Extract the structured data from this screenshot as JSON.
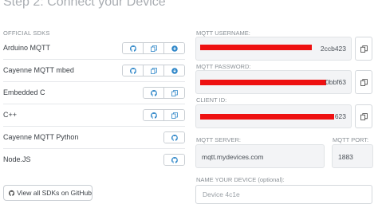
{
  "step_title": "Step 2: Connect your Device",
  "sdks": {
    "label": "OFFICIAL SDKS",
    "items": [
      {
        "name": "Arduino MQTT",
        "buttons": [
          "github-icon",
          "copy-icon",
          "download-icon"
        ]
      },
      {
        "name": "Cayenne MQTT mbed",
        "buttons": [
          "github-icon",
          "copy-icon",
          "download-icon"
        ]
      },
      {
        "name": "Embedded C",
        "buttons": [
          "github-icon",
          "copy-icon"
        ]
      },
      {
        "name": "C++",
        "buttons": [
          "github-icon",
          "copy-icon"
        ]
      },
      {
        "name": "Cayenne MQTT Python",
        "buttons": [
          "github-icon"
        ]
      },
      {
        "name": "Node.JS",
        "buttons": [
          "github-icon"
        ]
      }
    ],
    "github_button_label": "View all SDKs on GitHub"
  },
  "credentials": {
    "username_label": "MQTT USERNAME:",
    "username_value_visible": "2ccb423",
    "password_label": "MQTT PASSWORD:",
    "password_value_visible": "0bbf63",
    "client_id_label": "CLIENT ID:",
    "client_id_value_visible": "623",
    "server_label": "MQTT SERVER:",
    "server_value": "mqtt.mydevices.com",
    "port_label": "MQTT PORT:",
    "port_value": "1883",
    "device_name_label": "NAME YOUR DEVICE (optional):",
    "device_name_placeholder": "Device 4c1e"
  },
  "colors": {
    "accent_icon": "#2e86c8",
    "redaction": "#ee1111",
    "field_bg": "#f3f4f6"
  }
}
